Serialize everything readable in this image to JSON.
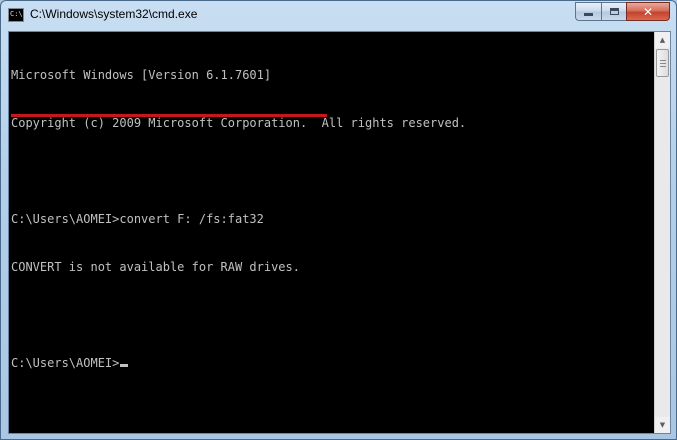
{
  "window": {
    "title": "C:\\Windows\\system32\\cmd.exe",
    "icon_text": "C:\\"
  },
  "controls": {
    "minimize": "minimize",
    "maximize": "maximize",
    "close": "✕"
  },
  "console": {
    "lines": [
      "Microsoft Windows [Version 6.1.7601]",
      "Copyright (c) 2009 Microsoft Corporation.  All rights reserved.",
      "",
      "C:\\Users\\AOMEI>convert F: /fs:fat32",
      "CONVERT is not available for RAW drives.",
      "",
      "C:\\Users\\AOMEI>"
    ]
  },
  "colors": {
    "console_bg": "#000000",
    "console_text": "#c0c0c0",
    "highlight_underline": "#c8161c"
  },
  "scrollbar": {
    "up_icon": "▲",
    "down_icon": "▼"
  }
}
